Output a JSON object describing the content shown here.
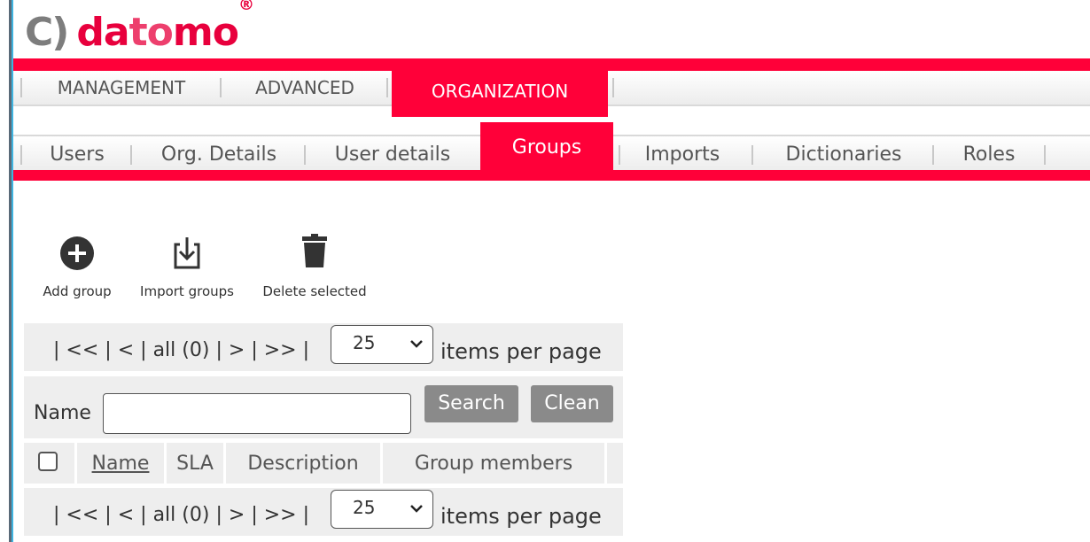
{
  "logo": {
    "mark": "C)",
    "part1": "da",
    "part2": "to",
    "part3": "mo",
    "reg": "®"
  },
  "main_menu": {
    "items": [
      "MANAGEMENT",
      "ADVANCED"
    ],
    "active": "ORGANIZATION"
  },
  "sub_menu": {
    "items": [
      "Users",
      "Org. Details",
      "User details"
    ],
    "active": "Groups",
    "items_after": [
      "Imports",
      "Dictionaries",
      "Roles"
    ]
  },
  "toolbar": {
    "add": "Add group",
    "import": "Import groups",
    "delete": "Delete selected"
  },
  "pager": {
    "sep": "|",
    "first": "<<",
    "prev": "<",
    "all": "all (0)",
    "next": ">",
    "last": ">>",
    "per_page_value": "25",
    "per_page_label": "items per page"
  },
  "search": {
    "label": "Name",
    "value": "",
    "search_btn": "Search",
    "clean_btn": "Clean"
  },
  "table": {
    "columns": [
      "Name",
      "SLA",
      "Description",
      "Group members"
    ]
  },
  "colors": {
    "accent": "#ff0039",
    "button_grey": "#8a8a8a",
    "row_grey": "#eeeeee"
  }
}
